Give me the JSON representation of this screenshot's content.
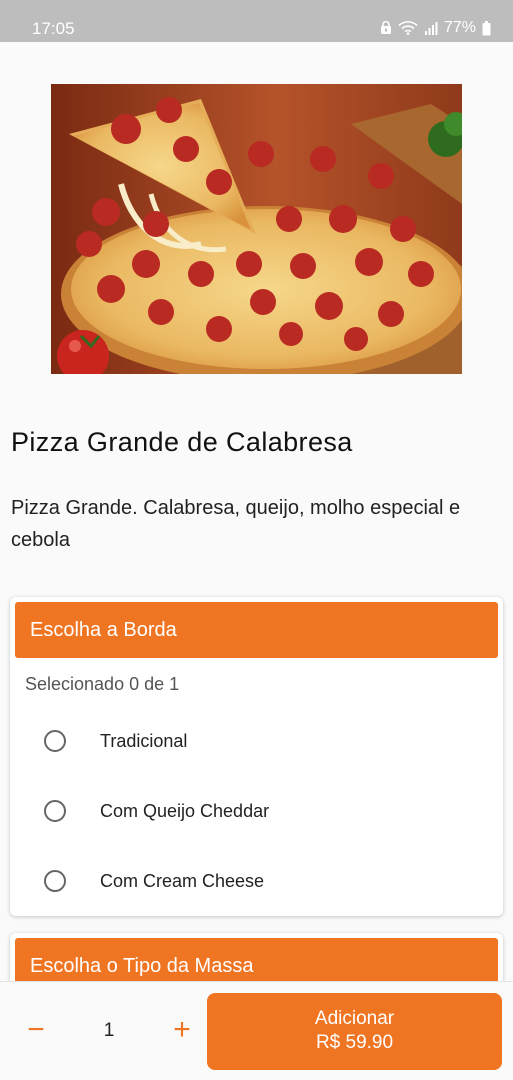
{
  "status_bar": {
    "time": "17:05",
    "battery": "77%",
    "icons": [
      "lock-icon",
      "wifi-icon",
      "signal-icon",
      "battery-icon"
    ]
  },
  "product": {
    "image": "pepperoni-pizza-photo",
    "title": "Pizza Grande de Calabresa",
    "description": "Pizza Grande. Calabresa, queijo, molho especial e cebola"
  },
  "groups": [
    {
      "title": "Escolha a Borda",
      "subtitle": "Selecionado 0 de 1",
      "options": [
        {
          "label": "Tradicional",
          "selected": false
        },
        {
          "label": "Com Queijo Cheddar",
          "selected": false
        },
        {
          "label": "Com Cream Cheese",
          "selected": false
        }
      ]
    },
    {
      "title": "Escolha o Tipo da Massa"
    }
  ],
  "cart": {
    "minus": "−",
    "quantity": "1",
    "plus": "+",
    "add_label": "Adicionar",
    "price": "R$ 59.90"
  },
  "colors": {
    "accent": "#f07522",
    "status_bar": "#bdbdbd",
    "background": "#fafafa"
  }
}
